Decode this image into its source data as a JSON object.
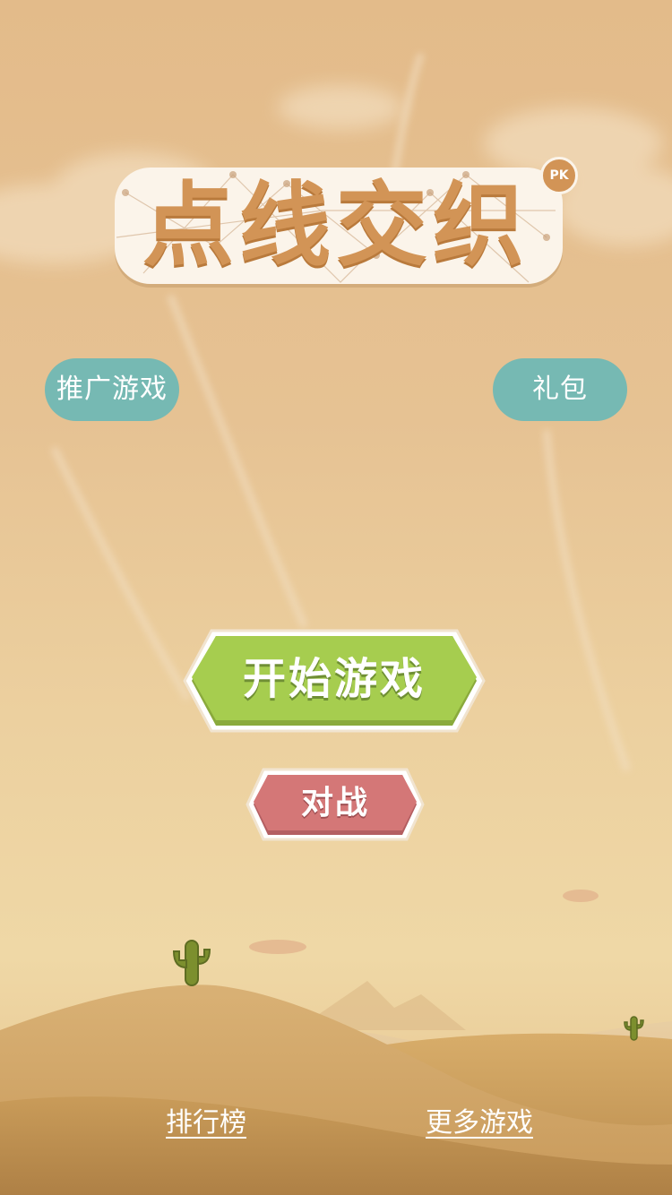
{
  "logo": {
    "title": "点线交织",
    "badge": "PK"
  },
  "buttons": {
    "promo_label": "推广游戏",
    "gift_label": "礼包",
    "start_label": "开始游戏",
    "battle_label": "对战"
  },
  "footer": {
    "leaderboard_label": "排行榜",
    "more_games_label": "更多游戏"
  },
  "colors": {
    "sky": "#e3bb8a",
    "logo_text": "#d29456",
    "teal_button": "#76b9b3",
    "start_button": "#a6cd4f",
    "battle_button": "#d47777",
    "dune_dark": "#b98a4e",
    "cactus": "#7c8f2e"
  },
  "icons": [
    "cactus-icon",
    "cactus-icon"
  ]
}
